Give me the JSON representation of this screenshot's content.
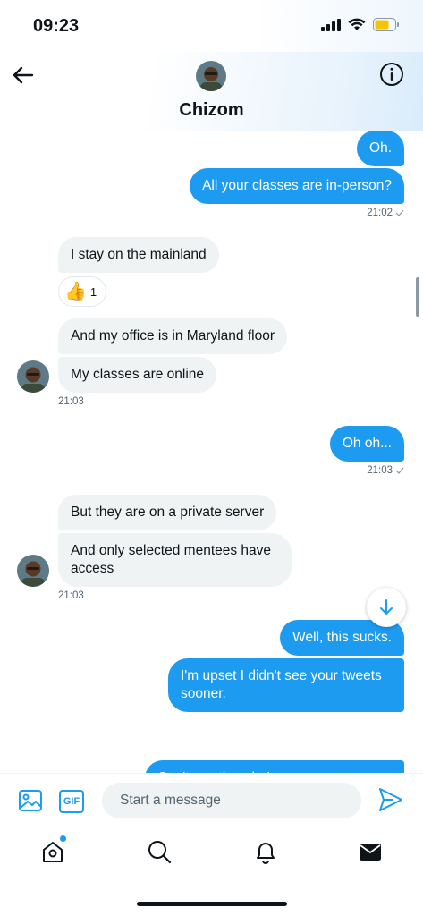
{
  "status_bar": {
    "time": "09:23"
  },
  "header": {
    "name": "Chizom"
  },
  "messages": {
    "m1": "Oh.",
    "m2": "All your classes are in-person?",
    "t1": "21:02",
    "m3": "I stay on the mainland",
    "reaction_count": "1",
    "reaction_emoji": "👍",
    "m4": "And my office is in Maryland floor",
    "m5": "My classes are online",
    "t2": "21:03",
    "m6": "Oh oh...",
    "t3": "21:03",
    "m7": "But they are on a private server",
    "m8": "And only selected mentees have access",
    "t4": "21:03",
    "m9": "Well, this sucks.",
    "m10": "I'm upset I didn't see your tweets sooner.",
    "m11": "Can't say the who's..."
  },
  "composer": {
    "placeholder": "Start a message",
    "gif_label": "GIF"
  },
  "colors": {
    "accent": "#1d9bf0",
    "incoming_bubble": "#eff3f4"
  }
}
